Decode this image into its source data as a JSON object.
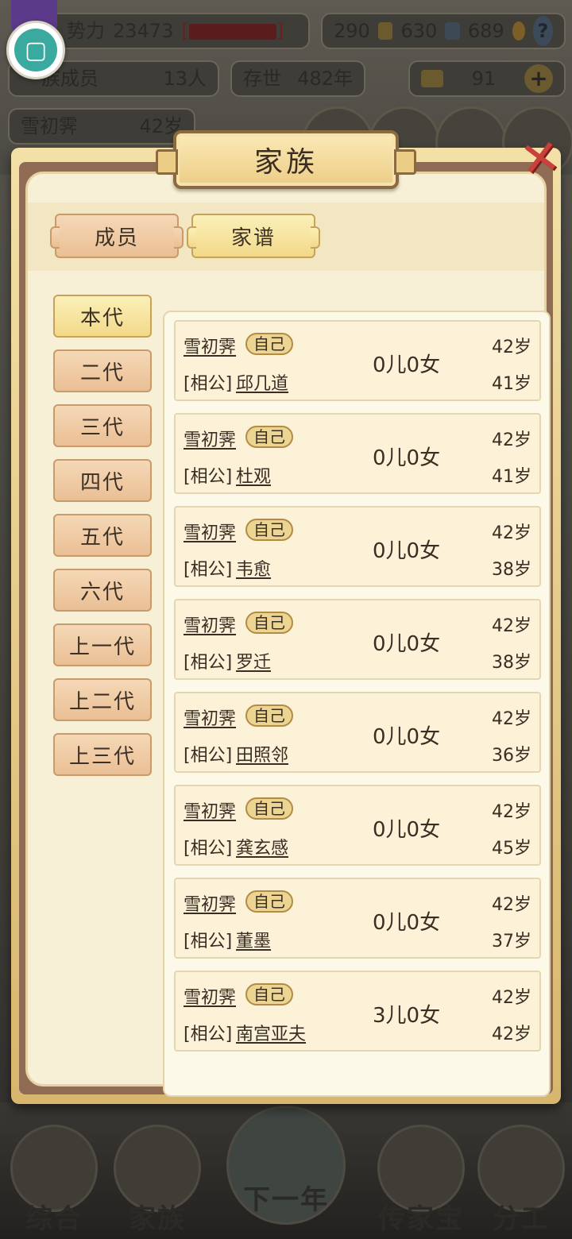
{
  "background": {
    "power_label": "势力",
    "power_value": "23473",
    "power_suffix": "[",
    "power_suffix_close": "]",
    "money": [
      "290",
      "630",
      "689"
    ],
    "members_label": "族成员",
    "members_value": "13人",
    "survive_label": "存世",
    "survive_value": "482年",
    "gold_value": "91",
    "current_name": "雪初霁",
    "current_age": "42岁"
  },
  "dialog": {
    "title": "家族",
    "tabs": [
      "成员",
      "家谱"
    ],
    "generations": [
      "本代",
      "二代",
      "三代",
      "四代",
      "五代",
      "六代",
      "上一代",
      "上二代",
      "上三代"
    ],
    "spouse_role": "[相公]",
    "self_badge": "自己",
    "records": [
      {
        "self_name": "雪初霁",
        "self_age": "42岁",
        "spouse_name": "邱几道",
        "spouse_age": "41岁",
        "children": "0儿0女"
      },
      {
        "self_name": "雪初霁",
        "self_age": "42岁",
        "spouse_name": "杜观",
        "spouse_age": "41岁",
        "children": "0儿0女"
      },
      {
        "self_name": "雪初霁",
        "self_age": "42岁",
        "spouse_name": "韦愈",
        "spouse_age": "38岁",
        "children": "0儿0女"
      },
      {
        "self_name": "雪初霁",
        "self_age": "42岁",
        "spouse_name": "罗迁",
        "spouse_age": "38岁",
        "children": "0儿0女"
      },
      {
        "self_name": "雪初霁",
        "self_age": "42岁",
        "spouse_name": "田照邻",
        "spouse_age": "36岁",
        "children": "0儿0女"
      },
      {
        "self_name": "雪初霁",
        "self_age": "42岁",
        "spouse_name": "龚玄感",
        "spouse_age": "45岁",
        "children": "0儿0女"
      },
      {
        "self_name": "雪初霁",
        "self_age": "42岁",
        "spouse_name": "董墨",
        "spouse_age": "37岁",
        "children": "0儿0女"
      },
      {
        "self_name": "雪初霁",
        "self_age": "42岁",
        "spouse_name": "南宫亚夫",
        "spouse_age": "42岁",
        "children": "3儿0女"
      }
    ]
  },
  "bottom_nav": [
    "综合",
    "家族",
    "下一年",
    "传家宝",
    "分工"
  ],
  "colors": {
    "panel_bg": "#f8f0d6",
    "frame_gold": "#e8c982",
    "frame_brown": "#8e6b52",
    "close_red": "#c9403c",
    "avatar_teal": "#3aa9a0"
  }
}
